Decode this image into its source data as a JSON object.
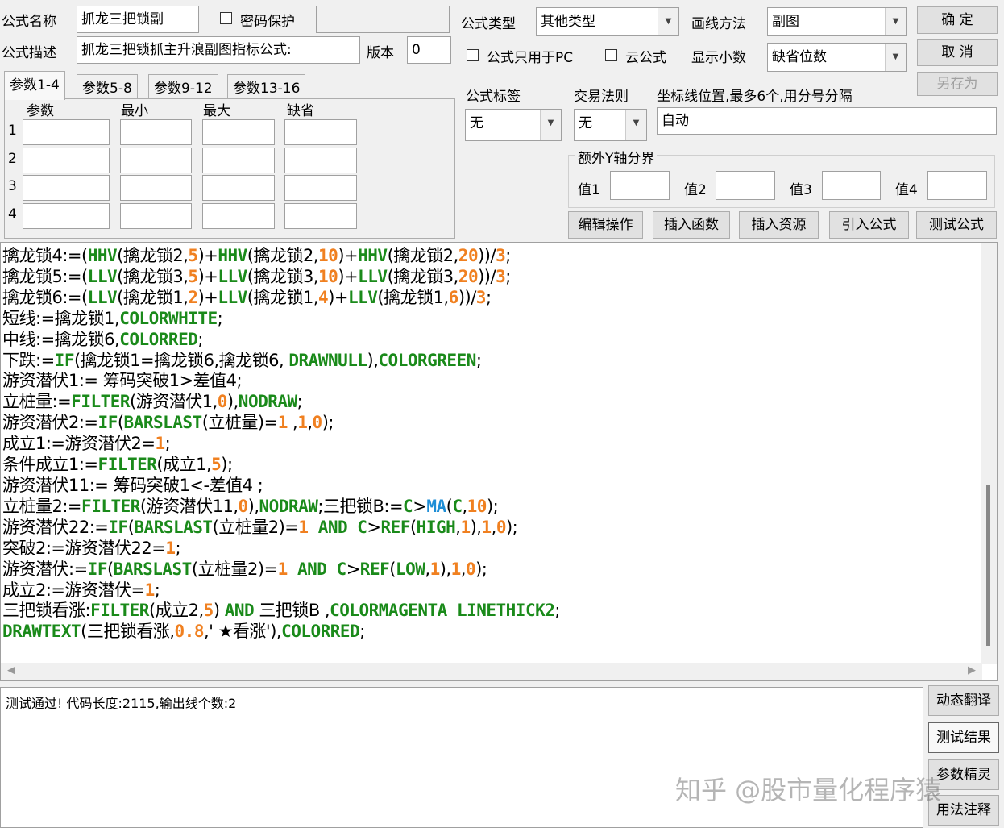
{
  "form": {
    "name_label": "公式名称",
    "name_value": "抓龙三把锁副",
    "password_label": "密码保护",
    "type_label": "公式类型",
    "type_value": "其他类型",
    "draw_label": "画线方法",
    "draw_value": "副图",
    "ok": "确  定",
    "desc_label": "公式描述",
    "desc_value": "抓龙三把锁抓主升浪副图指标公式:",
    "version_label": "版本",
    "version_value": "0",
    "pc_only_label": "公式只用于PC",
    "cloud_label": "云公式",
    "decimal_label": "显示小数",
    "decimal_value": "缺省位数",
    "cancel": "取  消",
    "save_as": "另存为"
  },
  "tabs": [
    "参数1-4",
    "参数5-8",
    "参数9-12",
    "参数13-16"
  ],
  "params": {
    "headers": [
      "参数",
      "最小",
      "最大",
      "缺省"
    ],
    "rows": [
      "1",
      "2",
      "3",
      "4"
    ]
  },
  "tag": {
    "label": "公式标签",
    "value": "无"
  },
  "rule": {
    "label": "交易法则",
    "value": "无"
  },
  "axis": {
    "label": "坐标线位置,最多6个,用分号分隔",
    "value": "自动"
  },
  "ybound": {
    "title": "额外Y轴分界",
    "labels": [
      "值1",
      "值2",
      "值3",
      "值4"
    ]
  },
  "actions": [
    "编辑操作",
    "插入函数",
    "插入资源",
    "引入公式",
    "测试公式"
  ],
  "code": [
    [
      [
        "擒龙锁4:=(",
        0
      ],
      [
        "HHV",
        1
      ],
      [
        "(擒龙锁2,",
        0
      ],
      [
        "5",
        2
      ],
      [
        ")+",
        0
      ],
      [
        "HHV",
        1
      ],
      [
        "(擒龙锁2,",
        0
      ],
      [
        "10",
        2
      ],
      [
        ")+",
        0
      ],
      [
        "HHV",
        1
      ],
      [
        "(擒龙锁2,",
        0
      ],
      [
        "20",
        2
      ],
      [
        "))/",
        0
      ],
      [
        "3",
        2
      ],
      [
        ";",
        0
      ]
    ],
    [
      [
        "擒龙锁5:=(",
        0
      ],
      [
        "LLV",
        1
      ],
      [
        "(擒龙锁3,",
        0
      ],
      [
        "5",
        2
      ],
      [
        ")+",
        0
      ],
      [
        "LLV",
        1
      ],
      [
        "(擒龙锁3,",
        0
      ],
      [
        "10",
        2
      ],
      [
        ")+",
        0
      ],
      [
        "LLV",
        1
      ],
      [
        "(擒龙锁3,",
        0
      ],
      [
        "20",
        2
      ],
      [
        "))/",
        0
      ],
      [
        "3",
        2
      ],
      [
        ";",
        0
      ]
    ],
    [
      [
        "擒龙锁6:=(",
        0
      ],
      [
        "LLV",
        1
      ],
      [
        "(擒龙锁1,",
        0
      ],
      [
        "2",
        2
      ],
      [
        ")+",
        0
      ],
      [
        "LLV",
        1
      ],
      [
        "(擒龙锁1,",
        0
      ],
      [
        "4",
        2
      ],
      [
        ")+",
        0
      ],
      [
        "LLV",
        1
      ],
      [
        "(擒龙锁1,",
        0
      ],
      [
        "6",
        2
      ],
      [
        "))/",
        0
      ],
      [
        "3",
        2
      ],
      [
        ";",
        0
      ]
    ],
    [
      [
        "短线:=擒龙锁1,",
        0
      ],
      [
        "COLORWHITE",
        1
      ],
      [
        ";",
        0
      ]
    ],
    [
      [
        "中线:=擒龙锁6,",
        0
      ],
      [
        "COLORRED",
        1
      ],
      [
        ";",
        0
      ]
    ],
    [
      [
        "下跌:=",
        0
      ],
      [
        "IF",
        1
      ],
      [
        "(擒龙锁1=擒龙锁6,擒龙锁6, ",
        0
      ],
      [
        "DRAWNULL",
        1
      ],
      [
        "),",
        0
      ],
      [
        "COLORGREEN",
        1
      ],
      [
        ";",
        0
      ]
    ],
    [
      [
        "游资潜伏1:= 筹码突破1>差值4;",
        0
      ]
    ],
    [
      [
        "立桩量:=",
        0
      ],
      [
        "FILTER",
        1
      ],
      [
        "(游资潜伏1,",
        0
      ],
      [
        "0",
        2
      ],
      [
        "),",
        0
      ],
      [
        "NODRAW",
        1
      ],
      [
        ";",
        0
      ]
    ],
    [
      [
        "游资潜伏2:=",
        0
      ],
      [
        "IF",
        1
      ],
      [
        "(",
        0
      ],
      [
        "BARSLAST",
        1
      ],
      [
        "(立桩量)=",
        0
      ],
      [
        "1",
        2
      ],
      [
        " ,",
        0
      ],
      [
        "1",
        2
      ],
      [
        ",",
        0
      ],
      [
        "0",
        2
      ],
      [
        ");",
        0
      ]
    ],
    [
      [
        "成立1:=游资潜伏2=",
        0
      ],
      [
        "1",
        2
      ],
      [
        ";",
        0
      ]
    ],
    [
      [
        "条件成立1:=",
        0
      ],
      [
        "FILTER",
        1
      ],
      [
        "(成立1,",
        0
      ],
      [
        "5",
        2
      ],
      [
        ");",
        0
      ]
    ],
    [
      [
        "游资潜伏11:= 筹码突破1<-差值4 ;",
        0
      ]
    ],
    [
      [
        "立桩量2:=",
        0
      ],
      [
        "FILTER",
        1
      ],
      [
        "(游资潜伏11,",
        0
      ],
      [
        "0",
        2
      ],
      [
        "),",
        0
      ],
      [
        "NODRAW",
        1
      ],
      [
        ";三把锁B:=",
        0
      ],
      [
        "C",
        1
      ],
      [
        ">",
        0
      ],
      [
        "MA",
        3
      ],
      [
        "(",
        0
      ],
      [
        "C",
        1
      ],
      [
        ",",
        0
      ],
      [
        "10",
        2
      ],
      [
        ");",
        0
      ]
    ],
    [
      [
        "游资潜伏22:=",
        0
      ],
      [
        "IF",
        1
      ],
      [
        "(",
        0
      ],
      [
        "BARSLAST",
        1
      ],
      [
        "(立桩量2)=",
        0
      ],
      [
        "1",
        2
      ],
      [
        " AND C",
        1
      ],
      [
        ">",
        0
      ],
      [
        "REF",
        1
      ],
      [
        "(",
        0
      ],
      [
        "HIGH",
        1
      ],
      [
        ",",
        0
      ],
      [
        "1",
        2
      ],
      [
        "),",
        0
      ],
      [
        "1",
        2
      ],
      [
        ",",
        0
      ],
      [
        "0",
        2
      ],
      [
        ");",
        0
      ]
    ],
    [
      [
        "突破2:=游资潜伏22=",
        0
      ],
      [
        "1",
        2
      ],
      [
        ";",
        0
      ]
    ],
    [
      [
        "游资潜伏:=",
        0
      ],
      [
        "IF",
        1
      ],
      [
        "(",
        0
      ],
      [
        "BARSLAST",
        1
      ],
      [
        "(立桩量2)=",
        0
      ],
      [
        "1",
        2
      ],
      [
        " AND C",
        1
      ],
      [
        ">",
        0
      ],
      [
        "REF",
        1
      ],
      [
        "(",
        0
      ],
      [
        "LOW",
        1
      ],
      [
        ",",
        0
      ],
      [
        "1",
        2
      ],
      [
        "),",
        0
      ],
      [
        "1",
        2
      ],
      [
        ",",
        0
      ],
      [
        "0",
        2
      ],
      [
        ");",
        0
      ]
    ],
    [
      [
        "成立2:=游资潜伏=",
        0
      ],
      [
        "1",
        2
      ],
      [
        ";",
        0
      ]
    ],
    [
      [
        "三把锁看涨:",
        0
      ],
      [
        "FILTER",
        1
      ],
      [
        "(成立2,",
        0
      ],
      [
        "5",
        2
      ],
      [
        ") ",
        0
      ],
      [
        "AND",
        1
      ],
      [
        " 三把锁B ,",
        0
      ],
      [
        "COLORMAGENTA LINETHICK2",
        1
      ],
      [
        ";",
        0
      ]
    ],
    [
      [
        "DRAWTEXT",
        1
      ],
      [
        "(三把锁看涨,",
        0
      ],
      [
        "0.8",
        2
      ],
      [
        ",' ★看涨'),",
        0
      ],
      [
        "COLORRED",
        1
      ],
      [
        ";",
        0
      ]
    ]
  ],
  "output": "测试通过! 代码长度:2115,输出线个数:2",
  "side_buttons": [
    "动态翻译",
    "测试结果",
    "参数精灵",
    "用法注释"
  ],
  "watermark": "知乎 @股市量化程序猿"
}
